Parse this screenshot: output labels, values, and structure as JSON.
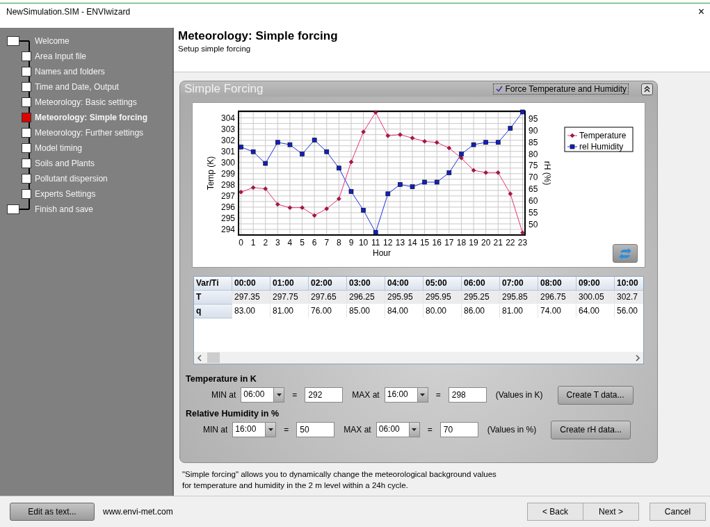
{
  "window": {
    "title": "NewSimulation.SIM - ENVIwizard",
    "close": "×"
  },
  "sidebar": {
    "items": [
      {
        "label": "Welcome",
        "selected": false
      },
      {
        "label": "Area Input file",
        "selected": false
      },
      {
        "label": "Names and folders",
        "selected": false
      },
      {
        "label": "Time and Date, Output",
        "selected": false
      },
      {
        "label": "Meteorology: Basic settings",
        "selected": false
      },
      {
        "label": "Meteorology: Simple forcing",
        "selected": true
      },
      {
        "label": "Meteorology: Further settings",
        "selected": false
      },
      {
        "label": "Model timing",
        "selected": false
      },
      {
        "label": "Soils and Plants",
        "selected": false
      },
      {
        "label": "Pollutant dispersion",
        "selected": false
      },
      {
        "label": "Experts Settings",
        "selected": false
      },
      {
        "label": "Finish and save",
        "selected": false
      }
    ]
  },
  "header": {
    "title": "Meteorology: Simple forcing",
    "subtitle": "Setup simple forcing"
  },
  "panel": {
    "title": "Simple Forcing",
    "force_checkbox": {
      "label": "Force Temperature and Humidity",
      "checked": true
    }
  },
  "chart": {
    "chart_data": {
      "type": "line",
      "grid": true,
      "legend": true,
      "xlabel": "Hour",
      "ylabel": "Temp (K)",
      "y2label": "rH (%)",
      "x": [
        0,
        1,
        2,
        3,
        4,
        5,
        6,
        7,
        8,
        9,
        10,
        11,
        12,
        13,
        14,
        15,
        16,
        17,
        18,
        19,
        20,
        21,
        22,
        23
      ],
      "xlim": [
        -0.2,
        23.2
      ],
      "ylim": [
        293.5,
        304.6
      ],
      "y2lim": [
        45.4,
        98.3
      ],
      "xticks": [
        0,
        1,
        2,
        3,
        4,
        5,
        6,
        7,
        8,
        9,
        10,
        11,
        12,
        13,
        14,
        15,
        16,
        17,
        18,
        19,
        20,
        21,
        22,
        23
      ],
      "yticks": [
        294,
        295,
        296,
        297,
        298,
        299,
        300,
        301,
        302,
        303,
        304
      ],
      "y2ticks": [
        50,
        55,
        60,
        65,
        70,
        75,
        80,
        85,
        90,
        95
      ],
      "series": [
        {
          "name": "Temperature",
          "color": "#e8307a",
          "marker": "diamond",
          "values": [
            297.35,
            297.75,
            297.65,
            296.25,
            295.95,
            295.95,
            295.25,
            295.85,
            296.75,
            300.05,
            302.75,
            304.5,
            302.4,
            302.5,
            302.2,
            301.9,
            301.8,
            301.3,
            300.4,
            299.3,
            299.1,
            299.1,
            297.2,
            293.7
          ]
        },
        {
          "name": "rel Humidity",
          "color": "#1f2fe0",
          "axis": "y2",
          "marker": "square",
          "values": [
            83,
            81,
            76,
            85,
            84,
            80,
            86,
            81,
            74,
            64,
            56,
            46.5,
            63,
            67,
            66,
            68,
            68,
            72,
            80,
            84,
            85,
            85,
            91,
            98
          ]
        }
      ]
    }
  },
  "table": {
    "columns": [
      "Var/Ti",
      "00:00",
      "01:00",
      "02:00",
      "03:00",
      "04:00",
      "05:00",
      "06:00",
      "07:00",
      "08:00",
      "09:00",
      "10:00"
    ],
    "rows": [
      {
        "cells": [
          "T",
          "297.35",
          "297.75",
          "297.65",
          "296.25",
          "295.95",
          "295.95",
          "295.25",
          "295.85",
          "296.75",
          "300.05",
          "302.7"
        ]
      },
      {
        "cells": [
          "q",
          "83.00",
          "81.00",
          "76.00",
          "85.00",
          "84.00",
          "80.00",
          "86.00",
          "81.00",
          "74.00",
          "64.00",
          "56.00"
        ]
      }
    ]
  },
  "forcing": [
    {
      "heading": "Temperature in K",
      "min_label": "MIN at",
      "min_time": "06:00",
      "equals_min": "=",
      "min_value": "292",
      "max_label": "MAX at",
      "max_time": "16:00",
      "equals_max": "=",
      "max_value": "298",
      "unit_note": "(Values in K)",
      "button": "Create T data..."
    },
    {
      "heading": "Relative Humidity in %",
      "min_label": "MIN at",
      "min_time": "16:00",
      "equals_min": "=",
      "min_value": "50",
      "max_label": "MAX at",
      "max_time": "06:00",
      "equals_max": "=",
      "max_value": "70",
      "unit_note": "(Values in %)",
      "button": "Create rH data..."
    }
  ],
  "note": "\"Simple forcing\" allows you to dynamically change the meteorological background values\nfor temperature and humidity in the 2 m level within a 24h cycle.",
  "footer": {
    "edit_button": "Edit as text...",
    "website": "www.envi-met.com",
    "back": "< Back",
    "next": "Next >",
    "cancel": "Cancel"
  }
}
